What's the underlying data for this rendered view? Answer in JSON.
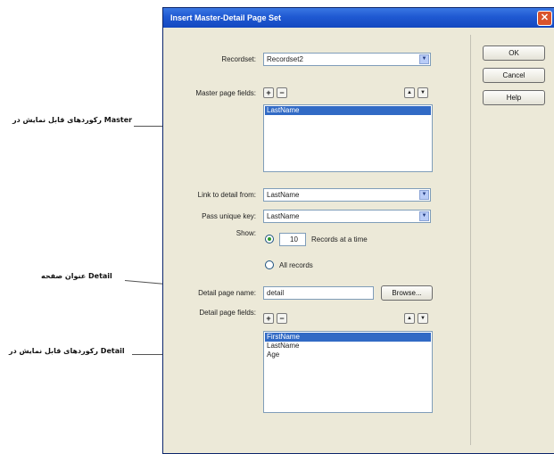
{
  "annotations": {
    "master_fields": "رکوردهای قابل نمایش در Master",
    "detail_title": "عنوان صفحه Detail",
    "detail_fields": "رکوردهای قابل نمایش در Detail"
  },
  "dialog": {
    "title": "Insert Master-Detail Page Set",
    "close_glyph": "✕",
    "recordset": {
      "label": "Recordset:",
      "value": "Recordset2"
    },
    "master_fields": {
      "label": "Master page fields:",
      "items": [
        "LastName"
      ],
      "selected_index": 0
    },
    "link_detail": {
      "label": "Link to detail from:",
      "value": "LastName"
    },
    "pass_key": {
      "label": "Pass unique key:",
      "value": "LastName"
    },
    "show": {
      "label": "Show:",
      "count": "10",
      "records_label": "Records at a time",
      "all_label": "All records",
      "selected": "records_at_a_time"
    },
    "detail_page_name": {
      "label": "Detail page name:",
      "value": "detail",
      "browse_label": "Browse..."
    },
    "detail_fields": {
      "label": "Detail page fields:",
      "items": [
        "FirstName",
        "LastName",
        "Age"
      ],
      "selected_index": 0
    },
    "buttons": {
      "ok": "OK",
      "cancel": "Cancel",
      "help": "Help"
    },
    "glyphs": {
      "add": "+",
      "remove": "−",
      "up": "▲",
      "down": "▼",
      "dropdown": "▼"
    }
  }
}
